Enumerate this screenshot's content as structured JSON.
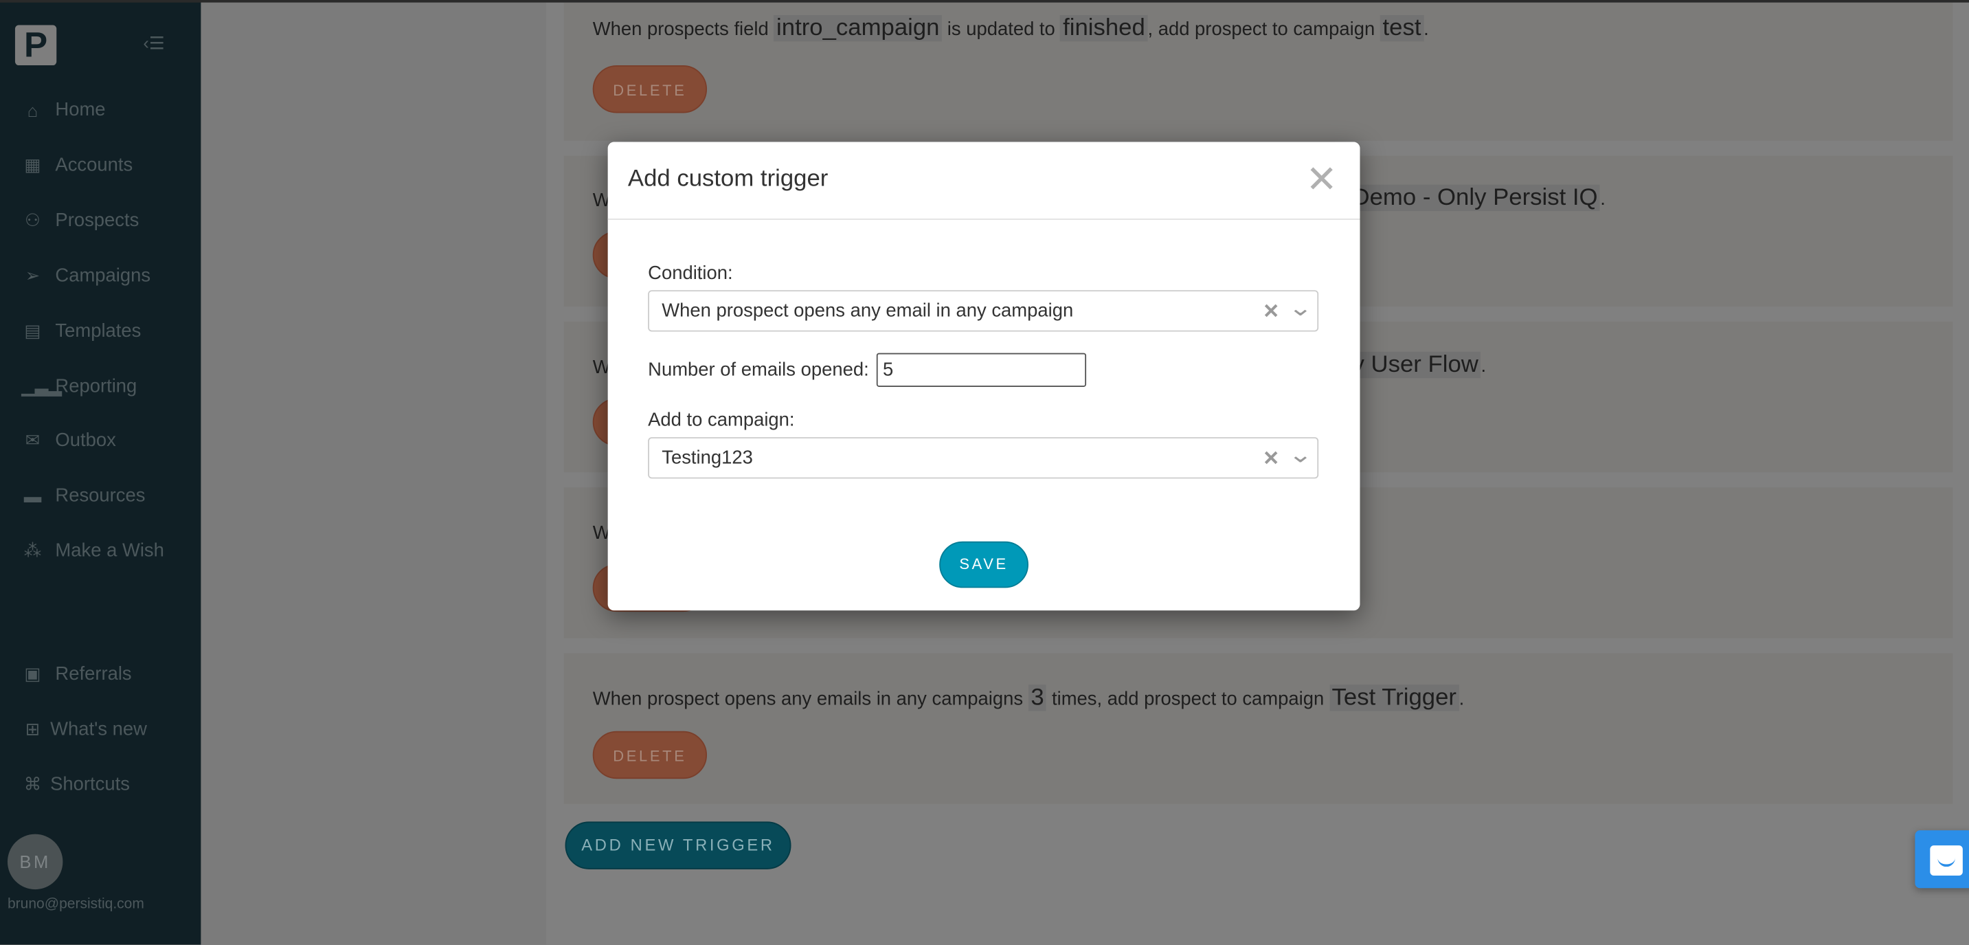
{
  "sidebar": {
    "logo": "P",
    "items": [
      {
        "label": "Home",
        "icon": "home-icon"
      },
      {
        "label": "Accounts",
        "icon": "building-icon"
      },
      {
        "label": "Prospects",
        "icon": "user-icon"
      },
      {
        "label": "Campaigns",
        "icon": "paper-plane-icon"
      },
      {
        "label": "Templates",
        "icon": "document-icon"
      },
      {
        "label": "Reporting",
        "icon": "bar-chart-icon"
      },
      {
        "label": "Outbox",
        "icon": "envelope-icon"
      },
      {
        "label": "Resources",
        "icon": "book-icon"
      },
      {
        "label": "Make a Wish",
        "icon": "magic-wand-icon"
      }
    ],
    "bottom_items": [
      {
        "label": "Referrals",
        "icon": "money-icon"
      },
      {
        "label": "What's new",
        "icon": "gift-icon"
      },
      {
        "label": "Shortcuts",
        "icon": "command-icon"
      }
    ],
    "user": {
      "initials": "BM",
      "email": "bruno@persistiq.com"
    }
  },
  "triggers": [
    {
      "t1": "When prospects field",
      "field": "intro_campaign",
      "t2": "is updated to",
      "value": "finished",
      "t3": ", add prospect to campaign",
      "campaign": "test",
      "t4": "."
    },
    {
      "prefix": "W",
      "visible_tail": "Demo - Only Persist IQ",
      "end": "."
    },
    {
      "prefix": "W",
      "visible_tail": "y User Flow",
      "end": "."
    },
    {
      "prefix": "W"
    },
    {
      "t1": "When prospect opens any emails in any campaigns",
      "count": "3",
      "t2": "times, add prospect to campaign",
      "campaign": "Test Trigger",
      "t3": "."
    }
  ],
  "delete_label": "DELETE",
  "add_new_trigger_label": "ADD NEW TRIGGER",
  "modal": {
    "title": "Add custom trigger",
    "condition_label": "Condition:",
    "condition_value": "When prospect opens any email in any campaign",
    "number_label": "Number of emails opened:",
    "number_value": "5",
    "campaign_label": "Add to campaign:",
    "campaign_value": "Testing123",
    "save_label": "SAVE"
  },
  "colors": {
    "save": "#0099b8",
    "delete": "#e0704a",
    "sidebar": "#1f3c49",
    "intercom": "#2b8ee8"
  }
}
